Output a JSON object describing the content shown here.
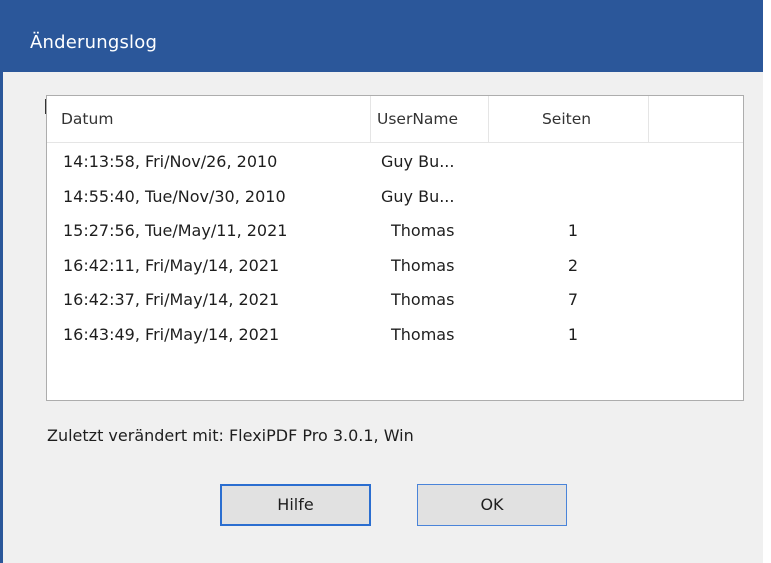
{
  "window": {
    "title": "Änderungslog"
  },
  "list": {
    "columns": [
      "Datum",
      "UserName",
      "Seiten",
      ""
    ],
    "rows": [
      {
        "datum": "14:13:58, Fri/Nov/26, 2010",
        "user": "Guy Bu...",
        "seiten": ""
      },
      {
        "datum": "14:55:40, Tue/Nov/30, 2010",
        "user": "Guy Bu...",
        "seiten": ""
      },
      {
        "datum": "15:27:56, Tue/May/11, 2021",
        "user": "Thomas",
        "seiten": "1"
      },
      {
        "datum": "16:42:11, Fri/May/14, 2021",
        "user": "Thomas",
        "seiten": "2"
      },
      {
        "datum": "16:42:37, Fri/May/14, 2021",
        "user": "Thomas",
        "seiten": "7"
      },
      {
        "datum": "16:43:49, Fri/May/14, 2021",
        "user": "Thomas",
        "seiten": "1"
      }
    ]
  },
  "status": {
    "text": "Zuletzt verändert mit: FlexiPDF Pro 3.0.1, Win"
  },
  "buttons": {
    "help_label": "Hilfe",
    "ok_label": "OK"
  },
  "colors": {
    "titlebar": "#2b579a",
    "dialog_bg": "#f0f0f0",
    "focus_border": "#2b6ed0"
  }
}
